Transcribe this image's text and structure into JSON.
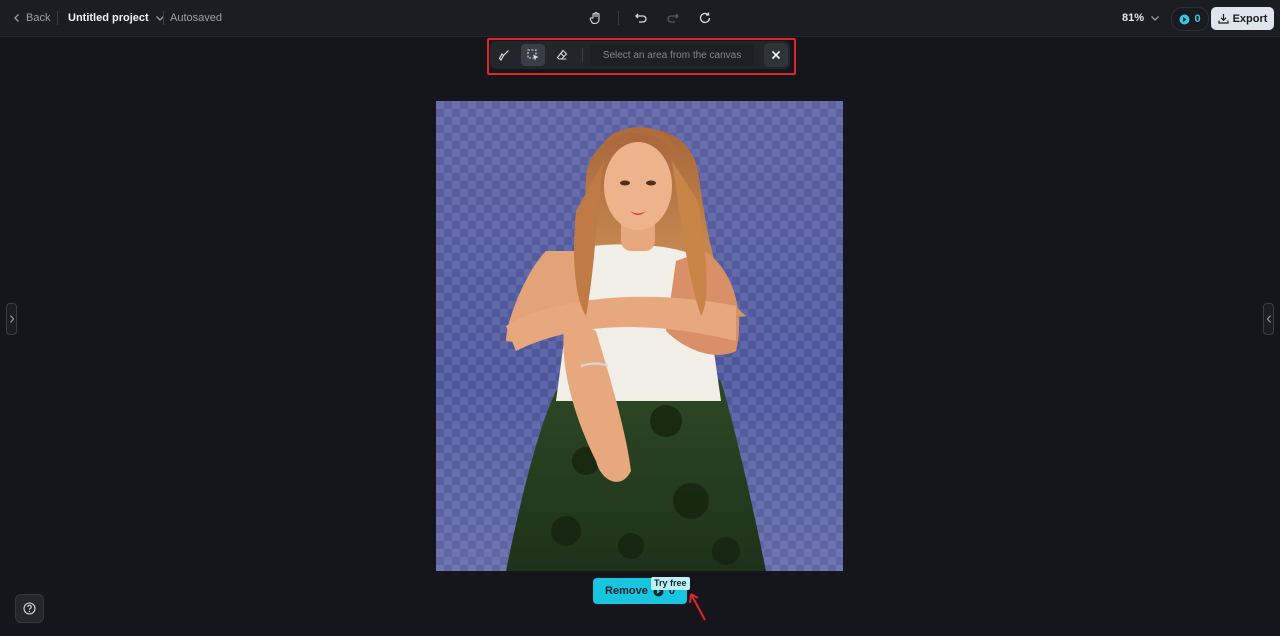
{
  "header": {
    "back_label": "Back",
    "project_title": "Untitled project",
    "autosave_status": "Autosaved",
    "zoom_level": "81%",
    "credits_count": "0",
    "export_label": "Export"
  },
  "selection_toolbar": {
    "hint_text": "Select an area from the canvas"
  },
  "canvas": {
    "remove_label": "Remove",
    "remove_cost": "0",
    "try_free_badge": "Try free"
  },
  "colors": {
    "accent": "#17c6de",
    "highlight_border": "#e0262b",
    "background": "#14161b"
  },
  "icons": [
    "chevron-left-icon",
    "chevron-down-icon",
    "hand-icon",
    "undo-icon",
    "redo-icon",
    "refresh-icon",
    "credit-icon",
    "download-icon",
    "brush-icon",
    "select-area-icon",
    "eraser-icon",
    "close-icon",
    "help-icon"
  ]
}
